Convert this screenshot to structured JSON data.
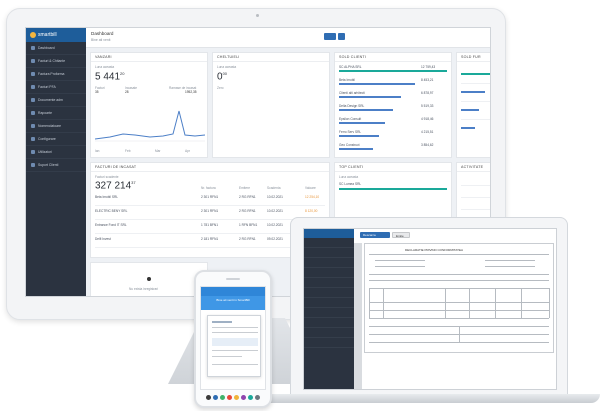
{
  "dashboard": {
    "brand": "smartbill",
    "title": "Dashboard",
    "subtitle": "Bine ati venit",
    "sidebar_items": [
      "Dashboard",
      "Facturi & Chitante",
      "Factura Proforma",
      "Facturi PFA",
      "Documente adm",
      "Rapoarte",
      "Nomenclatoare",
      "Configurare",
      "Utilizatori",
      "Suport Clienti"
    ],
    "cards": {
      "vanzari": {
        "title": "VANZARI",
        "caption": "Luna aceasta",
        "value": "5 441",
        "sup": "20",
        "stats": [
          {
            "label": "Facturi",
            "value": "35"
          },
          {
            "label": "Incasate",
            "value": "28"
          },
          {
            "label": "Ramase de incasat",
            "value": "1952,35"
          }
        ],
        "chart_axis": [
          "Ian",
          "Feb",
          "Mar",
          "Apr"
        ]
      },
      "cheltuieli": {
        "title": "CHELTUIELI",
        "caption": "Luna aceasta",
        "value": "0",
        "sup": "00",
        "note": "Zero"
      },
      "solduri": {
        "title": "SOLD CLIENTI",
        "rows": [
          {
            "name": "SC ALPHA SRL",
            "value": "12 759,43"
          },
          {
            "name": "Beta Imobil",
            "value": "8 453,21"
          },
          {
            "name": "Clienti alti arhitecti",
            "value": "6 878,97"
          },
          {
            "name": "Delta Design SRL",
            "value": "5 519,33"
          },
          {
            "name": "Epsilon Consult",
            "value": "4 918,46"
          },
          {
            "name": "Ferro Serv SRL",
            "value": "4 215,51"
          },
          {
            "name": "Geo Construct",
            "value": "3 854,62"
          }
        ]
      },
      "sold_furnizori": {
        "title": "SOLD FUR"
      },
      "facturi": {
        "title": "FACTURI DE INCASAT",
        "caption": "Facturi scadente",
        "value": "327 214",
        "sup": "37",
        "columns": [
          "Nr. factura",
          "Emitere",
          "Scadenta",
          "Valoare"
        ],
        "rows": [
          {
            "client": "Beta Imobil SRL",
            "nr": "2 301 RFN1",
            "emitere": "2 RG RFN1",
            "scadenta": "10.02.2021",
            "valoare": "12 254,10"
          },
          {
            "client": "ELECTRIC BENY SRL",
            "nr": "2 301 RFN1",
            "emitere": "2 RG RFN1",
            "scadenta": "10.02.2021",
            "valoare": "8 120,00"
          },
          {
            "client": "Entrance Fond IT SRL",
            "nr": "1 781 BFN1",
            "emitere": "1 RFN BFN1",
            "scadenta": "10.02.2021",
            "valoare": "6 214,55"
          },
          {
            "client": "Delfi Invest",
            "nr": "2 181 RFN1",
            "emitere": "2 RG RFN1",
            "scadenta": "09.02.2021",
            "valoare": "4 318,27"
          }
        ]
      },
      "top_clienti": {
        "title": "TOP CLIENTI",
        "caption": "Luna aceasta",
        "first": "SC Lumea SRL"
      },
      "activitate": {
        "title": "ACTIVITATE"
      },
      "empty": {
        "caption": "Nu exista inregistrari"
      }
    }
  },
  "laptop": {
    "doc_title": "DECLARATIE PRIVIND CONFORMITATEA",
    "btn_primary": "Descarca",
    "btn_secondary": "Emite"
  },
  "phone": {
    "header": "Bine ati venit in SmartBill",
    "colors": [
      "#3a3a3a",
      "#2f6db3",
      "#3fb26b",
      "#e8483b",
      "#f0b43a",
      "#8e44ad",
      "#1aa99a",
      "#6c757d"
    ]
  }
}
